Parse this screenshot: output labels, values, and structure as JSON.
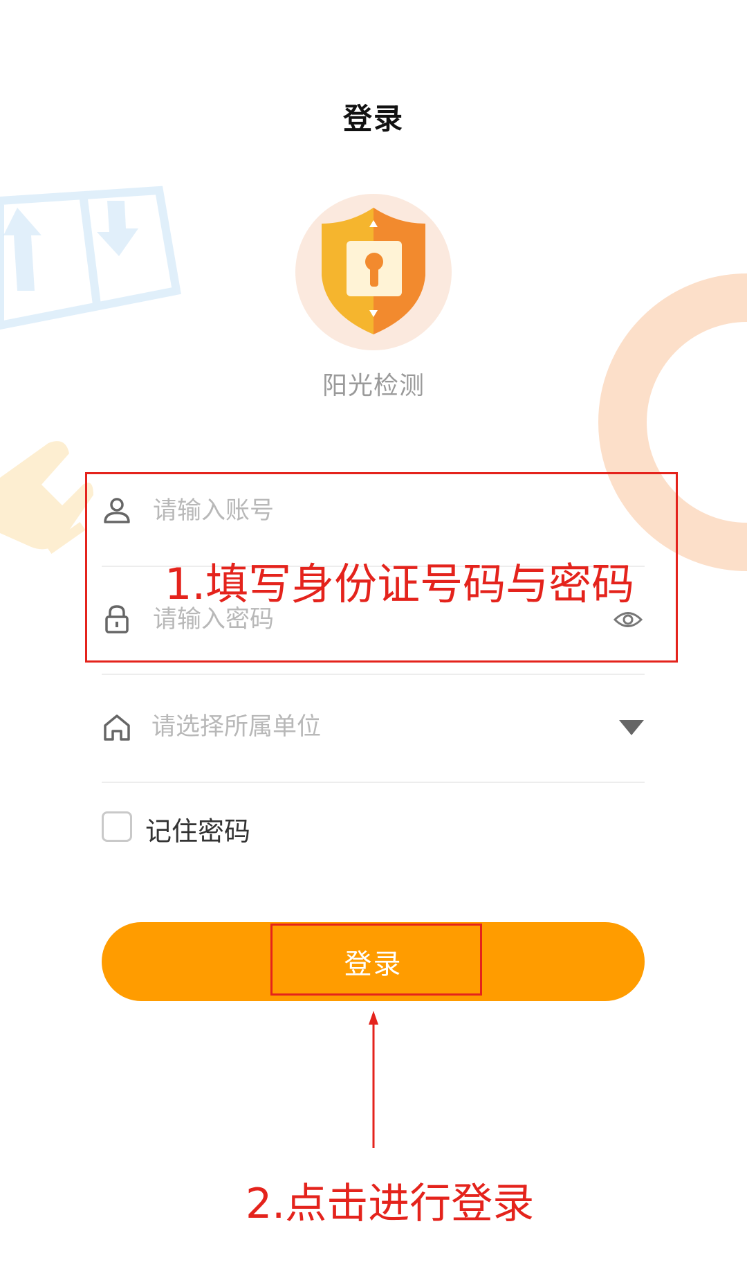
{
  "header": {
    "title": "登录"
  },
  "brand": {
    "app_name": "阳光检测",
    "logo_icon": "shield-lock-icon"
  },
  "form": {
    "account": {
      "placeholder": "请输入账号",
      "icon": "user-icon"
    },
    "password": {
      "placeholder": "请输入密码",
      "icon": "lock-icon",
      "toggle_icon": "eye-icon"
    },
    "unit": {
      "placeholder": "请选择所属单位",
      "icon": "home-icon",
      "dropdown_icon": "triangle-down-icon"
    },
    "remember": {
      "label": "记住密码",
      "checked": false
    }
  },
  "login_button": {
    "label": "登录"
  },
  "annotations": {
    "step1": "1.填写身份证号码与密码",
    "step2": "2.点击进行登录"
  },
  "colors": {
    "accent": "#ff9c00",
    "annotation": "#e4231c",
    "placeholder": "#b8b8b8"
  }
}
